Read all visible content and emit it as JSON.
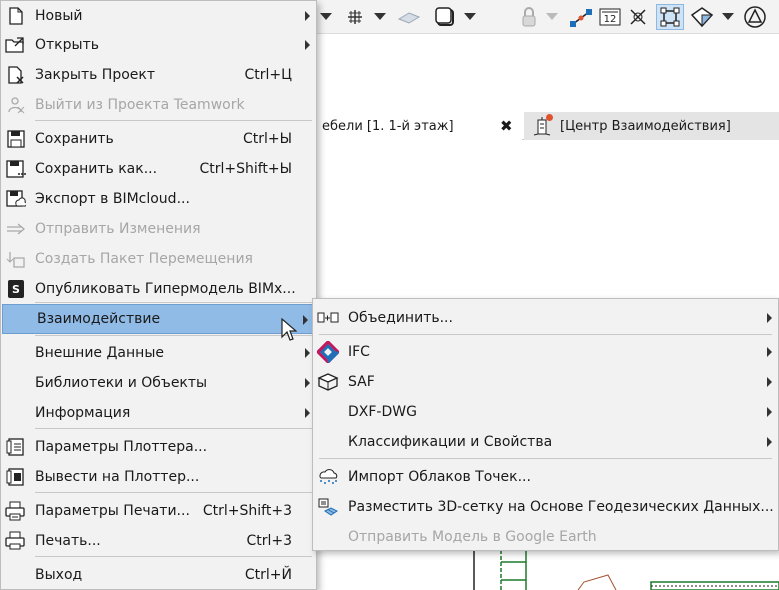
{
  "main_menu": {
    "items": [
      {
        "label": "Новый",
        "shortcut": "",
        "icon": "new-document-icon",
        "submenu": true,
        "disabled": false
      },
      {
        "label": "Открыть",
        "shortcut": "",
        "icon": "open-folder-icon",
        "submenu": true,
        "disabled": false
      },
      {
        "label": "Закрыть Проект",
        "shortcut": "Ctrl+Ц",
        "icon": "close-project-icon",
        "submenu": false,
        "disabled": false
      },
      {
        "label": "Выйти из Проекта Teamwork",
        "shortcut": "",
        "icon": "leave-teamwork-icon",
        "submenu": false,
        "disabled": true
      },
      {
        "label": "Сохранить",
        "shortcut": "Ctrl+Ы",
        "icon": "save-icon",
        "submenu": false,
        "disabled": false
      },
      {
        "label": "Сохранить как...",
        "shortcut": "Ctrl+Shift+Ы",
        "icon": "save-as-icon",
        "submenu": false,
        "disabled": false
      },
      {
        "label": "Экспорт в BIMcloud...",
        "shortcut": "",
        "icon": "bimcloud-export-icon",
        "submenu": false,
        "disabled": false
      },
      {
        "label": "Отправить Изменения",
        "shortcut": "",
        "icon": "send-changes-icon",
        "submenu": false,
        "disabled": true
      },
      {
        "label": "Создать Пакет Перемещения",
        "shortcut": "",
        "icon": "create-package-icon",
        "submenu": false,
        "disabled": true
      },
      {
        "label": "Опубликовать Гипермодель BIMx...",
        "shortcut": "",
        "icon": "bimx-icon",
        "submenu": false,
        "disabled": false
      },
      {
        "label": "Взаимодействие",
        "shortcut": "",
        "icon": "",
        "submenu": true,
        "disabled": false
      },
      {
        "label": "Внешние Данные",
        "shortcut": "",
        "icon": "",
        "submenu": true,
        "disabled": false
      },
      {
        "label": "Библиотеки и Объекты",
        "shortcut": "",
        "icon": "",
        "submenu": true,
        "disabled": false
      },
      {
        "label": "Информация",
        "shortcut": "",
        "icon": "",
        "submenu": true,
        "disabled": false
      },
      {
        "label": "Параметры Плоттера...",
        "shortcut": "",
        "icon": "plotter-setup-icon",
        "submenu": false,
        "disabled": false
      },
      {
        "label": "Вывести на Плоттер...",
        "shortcut": "",
        "icon": "plot-icon",
        "submenu": false,
        "disabled": false
      },
      {
        "label": "Параметры Печати...",
        "shortcut": "Ctrl+Shift+3",
        "icon": "print-setup-icon",
        "submenu": false,
        "disabled": false
      },
      {
        "label": "Печать...",
        "shortcut": "Ctrl+3",
        "icon": "printer-icon",
        "submenu": false,
        "disabled": false
      },
      {
        "label": "Выход",
        "shortcut": "Ctrl+Й",
        "icon": "",
        "submenu": false,
        "disabled": false
      }
    ],
    "active_index": 10
  },
  "submenu": {
    "items": [
      {
        "label": "Объединить...",
        "icon": "merge-icon",
        "submenu": true,
        "disabled": false
      },
      {
        "label": "IFC",
        "icon": "ifc-icon",
        "submenu": true,
        "disabled": false
      },
      {
        "label": "SAF",
        "icon": "saf-icon",
        "submenu": true,
        "disabled": false
      },
      {
        "label": "DXF-DWG",
        "icon": "",
        "submenu": true,
        "disabled": false
      },
      {
        "label": "Классификации и Свойства",
        "icon": "",
        "submenu": true,
        "disabled": false
      },
      {
        "label": "Импорт Облаков Точек...",
        "icon": "point-cloud-icon",
        "submenu": false,
        "disabled": false
      },
      {
        "label": "Разместить 3D-сетку на Основе Геодезических Данных...",
        "icon": "survey-mesh-icon",
        "submenu": false,
        "disabled": false
      },
      {
        "label": "Отправить Модель в Google Earth",
        "icon": "",
        "submenu": false,
        "disabled": true
      }
    ]
  },
  "tabs": [
    {
      "label": "ебели [1. 1-й этаж]",
      "close": "✖"
    },
    {
      "label": "[Центр Взаимодействия]",
      "icon": "collaboration-center-icon"
    }
  ],
  "colors": {
    "menu_bg": "#f2f2f2",
    "highlight": "#90bbe6",
    "disabled_text": "#a6a6a6",
    "ifc_magenta": "#c2185b",
    "ifc_blue": "#1e6fb8",
    "notify_dot": "#e0532e",
    "selected_tool": "#cfe3f7"
  }
}
